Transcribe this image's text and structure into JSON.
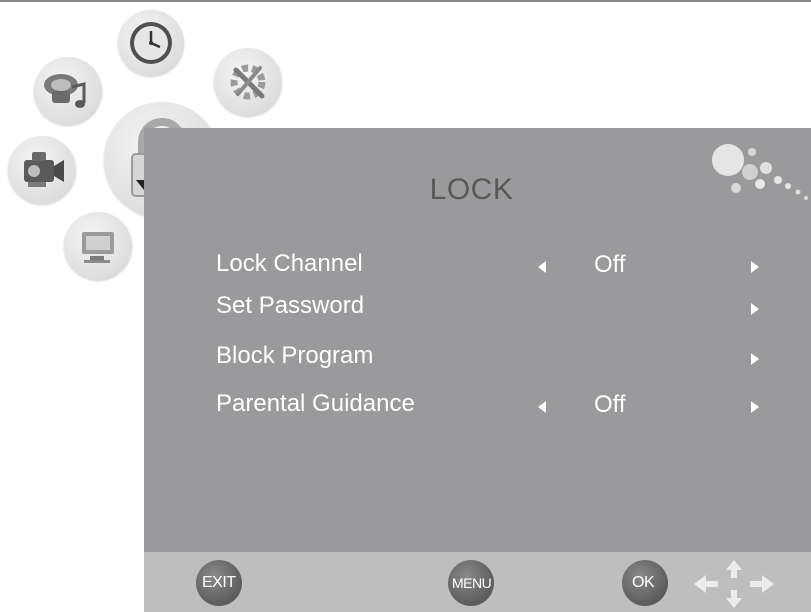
{
  "osd": {
    "title": "LOCK",
    "items": [
      {
        "label": "Lock Channel",
        "value": "Off",
        "has_left_arrow": true,
        "has_right_arrow": true
      },
      {
        "label": "Set Password",
        "value": "",
        "has_left_arrow": false,
        "has_right_arrow": true
      },
      {
        "label": "Block Program",
        "value": "",
        "has_left_arrow": false,
        "has_right_arrow": true
      },
      {
        "label": "Parental Guidance",
        "value": "Off",
        "has_left_arrow": true,
        "has_right_arrow": true
      }
    ]
  },
  "categories": [
    {
      "icon": "speaker-music-icon"
    },
    {
      "icon": "clock-icon"
    },
    {
      "icon": "tools-icon"
    },
    {
      "icon": "camcorder-icon"
    },
    {
      "icon": "lock-icon",
      "selected": true
    },
    {
      "icon": "monitor-icon"
    }
  ],
  "footer": {
    "exit_label": "EXIT",
    "menu_label": "MENU",
    "ok_label": "OK"
  },
  "colors": {
    "panel": "#9a9a9c",
    "footer": "#bebebe",
    "title_text": "#585858",
    "item_text": "#ffffff",
    "button": "#5f5f5f"
  }
}
